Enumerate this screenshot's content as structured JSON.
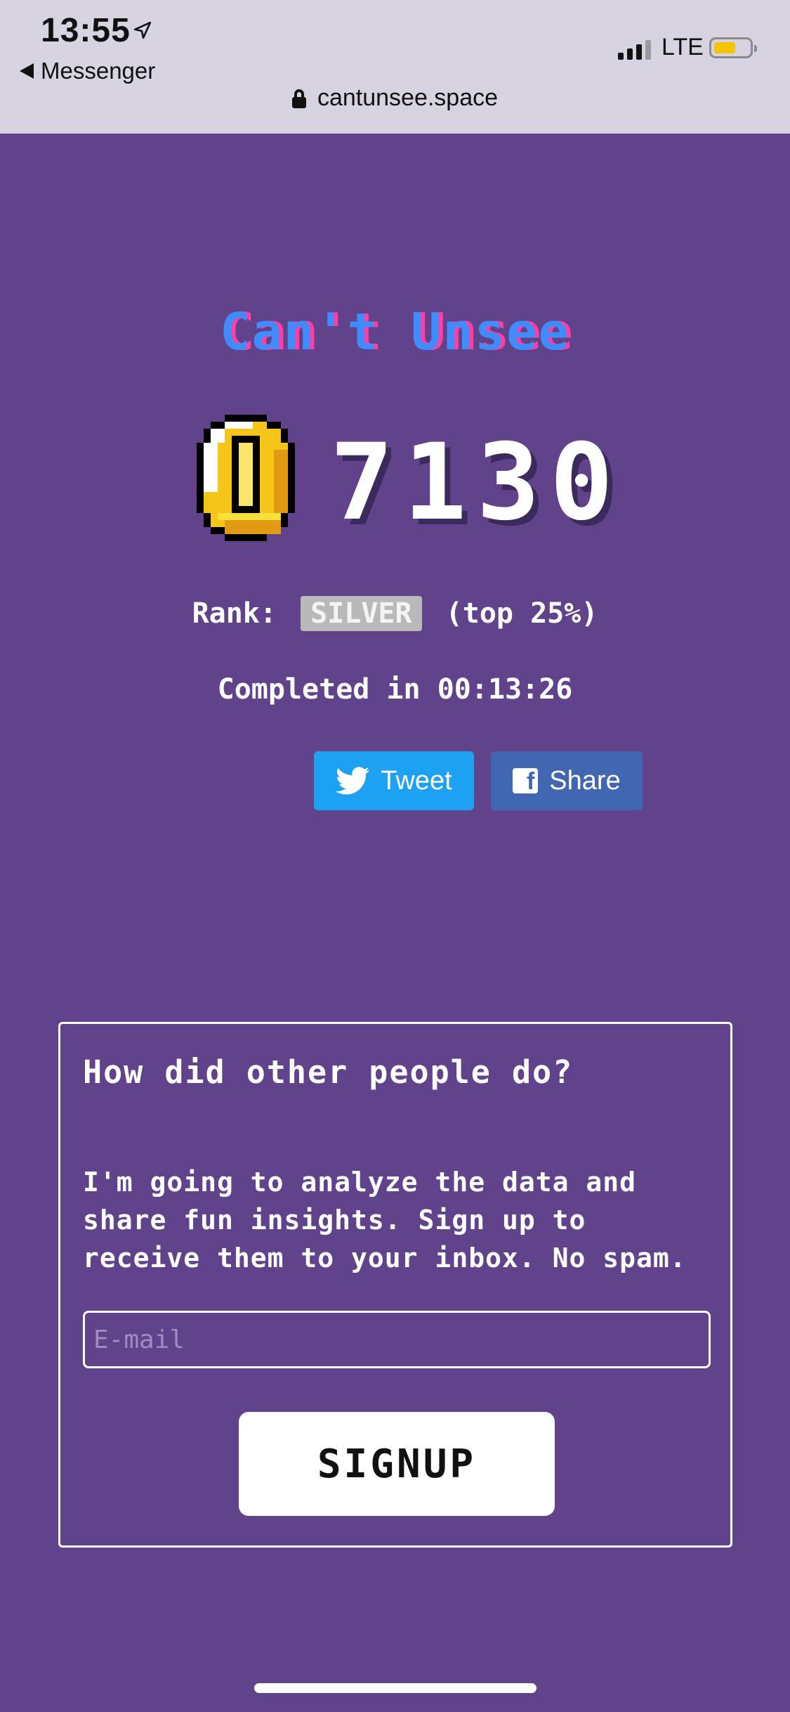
{
  "status_bar": {
    "time": "13:55",
    "back_label": "Messenger",
    "network": "LTE",
    "url": "cantunsee.space",
    "battery_color": "#f5c400"
  },
  "game": {
    "title": "Can't Unsee",
    "score": "7130",
    "rank_prefix": "Rank:",
    "rank_badge": "SILVER",
    "rank_suffix": "(top 25%)",
    "completed": "Completed in 00:13:26",
    "coin_icon": "coin-icon"
  },
  "share": {
    "tweet_label": "Tweet",
    "share_label": "Share",
    "tweet_color": "#1da1f2",
    "facebook_color": "#4267b2"
  },
  "signup_card": {
    "title": "How did other people do?",
    "body": "I'm going to analyze the data and share fun insights. Sign up to receive them to your inbox. No spam.",
    "email_placeholder": "E-mail",
    "button_label": "SIGNUP"
  },
  "colors": {
    "background": "#60438b",
    "title_blue": "#3f8cff",
    "title_pink": "#ff3fa6"
  }
}
